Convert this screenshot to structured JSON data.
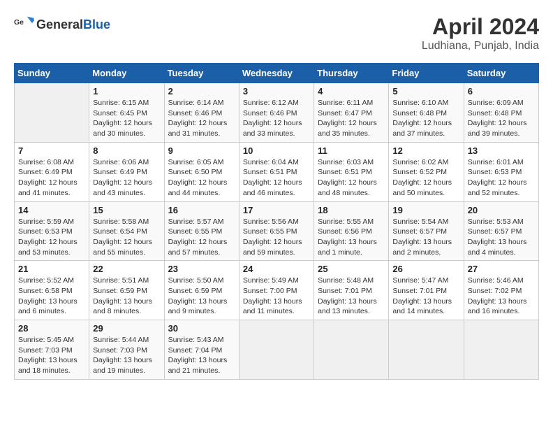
{
  "header": {
    "logo": {
      "general": "General",
      "blue": "Blue"
    },
    "title": "April 2024",
    "location": "Ludhiana, Punjab, India"
  },
  "columns": [
    "Sunday",
    "Monday",
    "Tuesday",
    "Wednesday",
    "Thursday",
    "Friday",
    "Saturday"
  ],
  "weeks": [
    [
      {
        "day": "",
        "info": ""
      },
      {
        "day": "1",
        "info": "Sunrise: 6:15 AM\nSunset: 6:45 PM\nDaylight: 12 hours\nand 30 minutes."
      },
      {
        "day": "2",
        "info": "Sunrise: 6:14 AM\nSunset: 6:46 PM\nDaylight: 12 hours\nand 31 minutes."
      },
      {
        "day": "3",
        "info": "Sunrise: 6:12 AM\nSunset: 6:46 PM\nDaylight: 12 hours\nand 33 minutes."
      },
      {
        "day": "4",
        "info": "Sunrise: 6:11 AM\nSunset: 6:47 PM\nDaylight: 12 hours\nand 35 minutes."
      },
      {
        "day": "5",
        "info": "Sunrise: 6:10 AM\nSunset: 6:48 PM\nDaylight: 12 hours\nand 37 minutes."
      },
      {
        "day": "6",
        "info": "Sunrise: 6:09 AM\nSunset: 6:48 PM\nDaylight: 12 hours\nand 39 minutes."
      }
    ],
    [
      {
        "day": "7",
        "info": "Sunrise: 6:08 AM\nSunset: 6:49 PM\nDaylight: 12 hours\nand 41 minutes."
      },
      {
        "day": "8",
        "info": "Sunrise: 6:06 AM\nSunset: 6:49 PM\nDaylight: 12 hours\nand 43 minutes."
      },
      {
        "day": "9",
        "info": "Sunrise: 6:05 AM\nSunset: 6:50 PM\nDaylight: 12 hours\nand 44 minutes."
      },
      {
        "day": "10",
        "info": "Sunrise: 6:04 AM\nSunset: 6:51 PM\nDaylight: 12 hours\nand 46 minutes."
      },
      {
        "day": "11",
        "info": "Sunrise: 6:03 AM\nSunset: 6:51 PM\nDaylight: 12 hours\nand 48 minutes."
      },
      {
        "day": "12",
        "info": "Sunrise: 6:02 AM\nSunset: 6:52 PM\nDaylight: 12 hours\nand 50 minutes."
      },
      {
        "day": "13",
        "info": "Sunrise: 6:01 AM\nSunset: 6:53 PM\nDaylight: 12 hours\nand 52 minutes."
      }
    ],
    [
      {
        "day": "14",
        "info": "Sunrise: 5:59 AM\nSunset: 6:53 PM\nDaylight: 12 hours\nand 53 minutes."
      },
      {
        "day": "15",
        "info": "Sunrise: 5:58 AM\nSunset: 6:54 PM\nDaylight: 12 hours\nand 55 minutes."
      },
      {
        "day": "16",
        "info": "Sunrise: 5:57 AM\nSunset: 6:55 PM\nDaylight: 12 hours\nand 57 minutes."
      },
      {
        "day": "17",
        "info": "Sunrise: 5:56 AM\nSunset: 6:55 PM\nDaylight: 12 hours\nand 59 minutes."
      },
      {
        "day": "18",
        "info": "Sunrise: 5:55 AM\nSunset: 6:56 PM\nDaylight: 13 hours\nand 1 minute."
      },
      {
        "day": "19",
        "info": "Sunrise: 5:54 AM\nSunset: 6:57 PM\nDaylight: 13 hours\nand 2 minutes."
      },
      {
        "day": "20",
        "info": "Sunrise: 5:53 AM\nSunset: 6:57 PM\nDaylight: 13 hours\nand 4 minutes."
      }
    ],
    [
      {
        "day": "21",
        "info": "Sunrise: 5:52 AM\nSunset: 6:58 PM\nDaylight: 13 hours\nand 6 minutes."
      },
      {
        "day": "22",
        "info": "Sunrise: 5:51 AM\nSunset: 6:59 PM\nDaylight: 13 hours\nand 8 minutes."
      },
      {
        "day": "23",
        "info": "Sunrise: 5:50 AM\nSunset: 6:59 PM\nDaylight: 13 hours\nand 9 minutes."
      },
      {
        "day": "24",
        "info": "Sunrise: 5:49 AM\nSunset: 7:00 PM\nDaylight: 13 hours\nand 11 minutes."
      },
      {
        "day": "25",
        "info": "Sunrise: 5:48 AM\nSunset: 7:01 PM\nDaylight: 13 hours\nand 13 minutes."
      },
      {
        "day": "26",
        "info": "Sunrise: 5:47 AM\nSunset: 7:01 PM\nDaylight: 13 hours\nand 14 minutes."
      },
      {
        "day": "27",
        "info": "Sunrise: 5:46 AM\nSunset: 7:02 PM\nDaylight: 13 hours\nand 16 minutes."
      }
    ],
    [
      {
        "day": "28",
        "info": "Sunrise: 5:45 AM\nSunset: 7:03 PM\nDaylight: 13 hours\nand 18 minutes."
      },
      {
        "day": "29",
        "info": "Sunrise: 5:44 AM\nSunset: 7:03 PM\nDaylight: 13 hours\nand 19 minutes."
      },
      {
        "day": "30",
        "info": "Sunrise: 5:43 AM\nSunset: 7:04 PM\nDaylight: 13 hours\nand 21 minutes."
      },
      {
        "day": "",
        "info": ""
      },
      {
        "day": "",
        "info": ""
      },
      {
        "day": "",
        "info": ""
      },
      {
        "day": "",
        "info": ""
      }
    ]
  ]
}
